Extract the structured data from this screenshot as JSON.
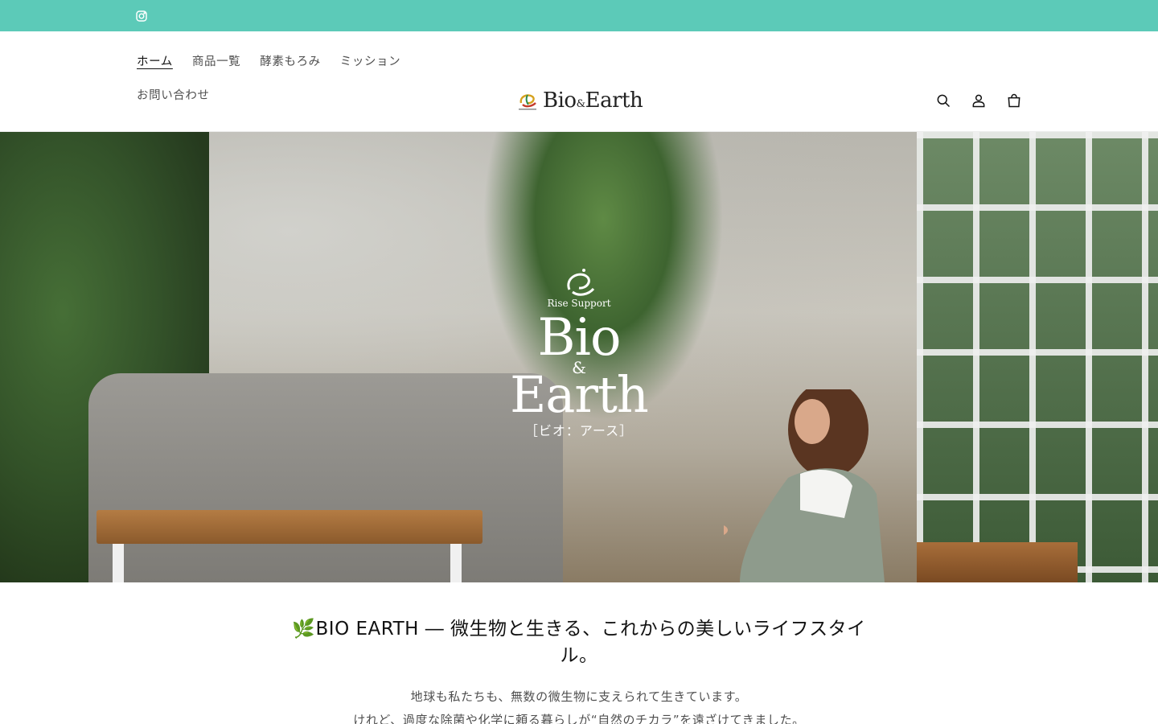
{
  "announcement": {
    "social_icon": "instagram-icon",
    "bg_color": "#5ccab8"
  },
  "header": {
    "nav": [
      {
        "label": "ホーム",
        "active": true
      },
      {
        "label": "商品一覧",
        "active": false
      },
      {
        "label": "酵素もろみ",
        "active": false
      },
      {
        "label": "ミッション",
        "active": false
      },
      {
        "label": "お問い合わせ",
        "active": false
      }
    ],
    "logo": {
      "main": "Bio",
      "amp": "&",
      "tail": "Earth",
      "mark_caption": "Rise Support"
    },
    "icons": [
      "search-icon",
      "account-icon",
      "cart-icon"
    ]
  },
  "hero": {
    "sub": "Rise Support",
    "bio": "Bio",
    "amp": "&",
    "earth": "Earth",
    "kana": "［ビオ：アース］"
  },
  "intro": {
    "heading": "🌿BIO EARTH ― 微生物と生きる、これからの美しいライフスタイル。",
    "line1": "地球も私たちも、無数の微生物に支えられて生きています。",
    "line2": "けれど、過度な除菌や化学に頼る暮らしが“自然のチカラ”を遠ざけてきました。"
  }
}
